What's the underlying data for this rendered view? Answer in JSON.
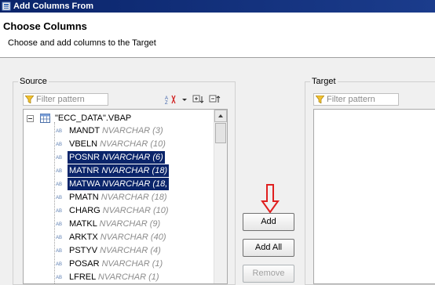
{
  "window": {
    "title": "Add Columns From"
  },
  "header": {
    "title": "Choose Columns",
    "description": "Choose and add columns to the Target"
  },
  "source": {
    "label": "Source",
    "filter_placeholder": "Filter pattern",
    "root": {
      "label": "\"ECC_DATA\".VBAP"
    },
    "columns": [
      {
        "name": "MANDT",
        "type": "NVARCHAR (3)",
        "selected": false
      },
      {
        "name": "VBELN",
        "type": "NVARCHAR (10)",
        "selected": false
      },
      {
        "name": "POSNR",
        "type": "NVARCHAR (6)",
        "selected": true
      },
      {
        "name": "MATNR",
        "type": "NVARCHAR (18)",
        "selected": true
      },
      {
        "name": "MATWA",
        "type": "NVARCHAR (18,",
        "selected": true
      },
      {
        "name": "PMATN",
        "type": "NVARCHAR (18)",
        "selected": false
      },
      {
        "name": "CHARG",
        "type": "NVARCHAR (10)",
        "selected": false
      },
      {
        "name": "MATKL",
        "type": "NVARCHAR (9)",
        "selected": false
      },
      {
        "name": "ARKTX",
        "type": "NVARCHAR (40)",
        "selected": false
      },
      {
        "name": "PSTYV",
        "type": "NVARCHAR (4)",
        "selected": false
      },
      {
        "name": "POSAR",
        "type": "NVARCHAR (1)",
        "selected": false
      },
      {
        "name": "LFREL",
        "type": "NVARCHAR (1)",
        "selected": false
      }
    ],
    "type_badge": "AB",
    "expand_symbol": "−"
  },
  "target": {
    "label": "Target",
    "filter_placeholder": "Filter pattern"
  },
  "buttons": {
    "add": "Add",
    "add_all": "Add All",
    "remove": "Remove"
  },
  "colors": {
    "title_bar": "#0a246a",
    "selection": "#0a246a",
    "arrow": "#e02020"
  }
}
